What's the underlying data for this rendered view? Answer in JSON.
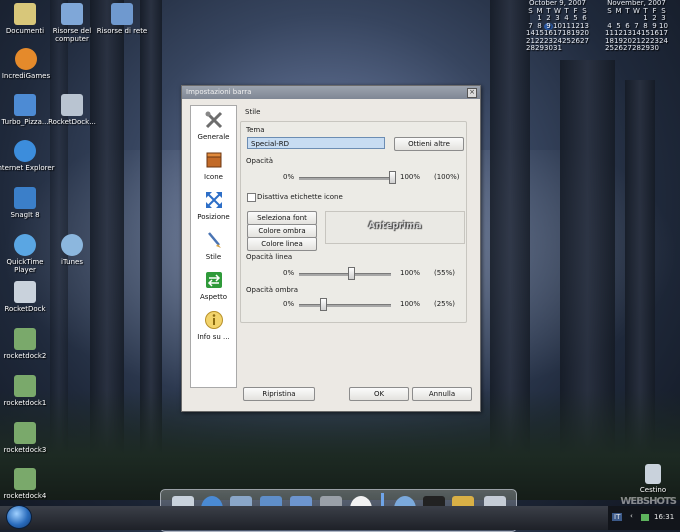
{
  "desktop_icons": [
    {
      "label": "Documenti",
      "color": "#d8c77a"
    },
    {
      "label": "Risorse del computer",
      "color": "#7fa7d8"
    },
    {
      "label": "Risorse di rete",
      "color": "#6f99cf"
    },
    {
      "label": "IncrediGames",
      "color": "#e58a2b"
    },
    {
      "label": "Turbo_Pizza...",
      "color": "#4d8bd4"
    },
    {
      "label": "RocketDock...",
      "color": "#b9c4d1"
    },
    {
      "label": "Internet Explorer",
      "color": "#3c8ddc"
    },
    {
      "label": "SnagIt 8",
      "color": "#3b7fc9"
    },
    {
      "label": "QuickTime Player",
      "color": "#5aa6e3"
    },
    {
      "label": "iTunes",
      "color": "#8cb7de"
    },
    {
      "label": "RocketDock",
      "color": "#c9d2dc"
    },
    {
      "label": "rocketdock2",
      "color": "#7aa96b"
    },
    {
      "label": "rocketdock1",
      "color": "#7aa96b"
    },
    {
      "label": "rocketdock3",
      "color": "#7aa96b"
    },
    {
      "label": "rocketdock4",
      "color": "#7aa96b"
    },
    {
      "label": "Cestino",
      "color": "#c9d2dc"
    }
  ],
  "calendars": [
    {
      "title": "October 9, 2007",
      "days": [
        "S",
        "M",
        "T",
        "W",
        "T",
        "F",
        "S"
      ],
      "weeks": [
        [
          "",
          "1",
          "2",
          "3",
          "4",
          "5",
          "6"
        ],
        [
          "7",
          "8",
          "9",
          "10",
          "11",
          "12",
          "13"
        ],
        [
          "14",
          "15",
          "16",
          "17",
          "18",
          "19",
          "20"
        ],
        [
          "21",
          "22",
          "23",
          "24",
          "25",
          "26",
          "27"
        ],
        [
          "28",
          "29",
          "30",
          "31",
          "",
          "",
          ""
        ]
      ],
      "today": "9"
    },
    {
      "title": "November, 2007",
      "days": [
        "S",
        "M",
        "T",
        "W",
        "T",
        "F",
        "S"
      ],
      "weeks": [
        [
          "",
          "",
          "",
          "",
          "1",
          "2",
          "3"
        ],
        [
          "4",
          "5",
          "6",
          "7",
          "8",
          "9",
          "10"
        ],
        [
          "11",
          "12",
          "13",
          "14",
          "15",
          "16",
          "17"
        ],
        [
          "18",
          "19",
          "20",
          "21",
          "22",
          "23",
          "24"
        ],
        [
          "25",
          "26",
          "27",
          "28",
          "29",
          "30",
          ""
        ]
      ],
      "today": ""
    }
  ],
  "dialog": {
    "title": "Impostazioni barra",
    "close": "×",
    "sidebar": [
      {
        "label": "Generale",
        "icon": "tools-icon"
      },
      {
        "label": "Icone",
        "icon": "box-icon"
      },
      {
        "label": "Posizione",
        "icon": "arrows-icon"
      },
      {
        "label": "Stile",
        "icon": "brush-icon"
      },
      {
        "label": "Aspetto",
        "icon": "switch-icon"
      },
      {
        "label": "Info su ...",
        "icon": "info-icon"
      }
    ],
    "section": "Stile",
    "tema_label": "Tema",
    "tema_value": "Special-RD",
    "get_more": "Ottieni altre",
    "opacity_label": "Opacità",
    "opacity_min": "0%",
    "opacity_max": "100%",
    "opacity_value": "(100%)",
    "opacity_fraction": 1.0,
    "disable_labels": "Disattiva etichette icone",
    "font_btn": "Seleziona font",
    "shadow_btn": "Colore ombra",
    "line_btn": "Colore linea",
    "preview": "Anteprima",
    "line_opacity_label": "Opacità linea",
    "line_min": "0%",
    "line_max": "100%",
    "line_value": "(55%)",
    "line_fraction": 0.55,
    "shadow_opacity_label": "Opacità ombra",
    "shadow_min": "0%",
    "shadow_max": "100%",
    "shadow_value": "(25%)",
    "shadow_fraction": 0.25,
    "reset": "Ripristina",
    "ok": "OK",
    "cancel": "Annulla"
  },
  "taskbar": {
    "lang": "IT",
    "time": "16:31",
    "watermark": "WEBSHOTS"
  }
}
